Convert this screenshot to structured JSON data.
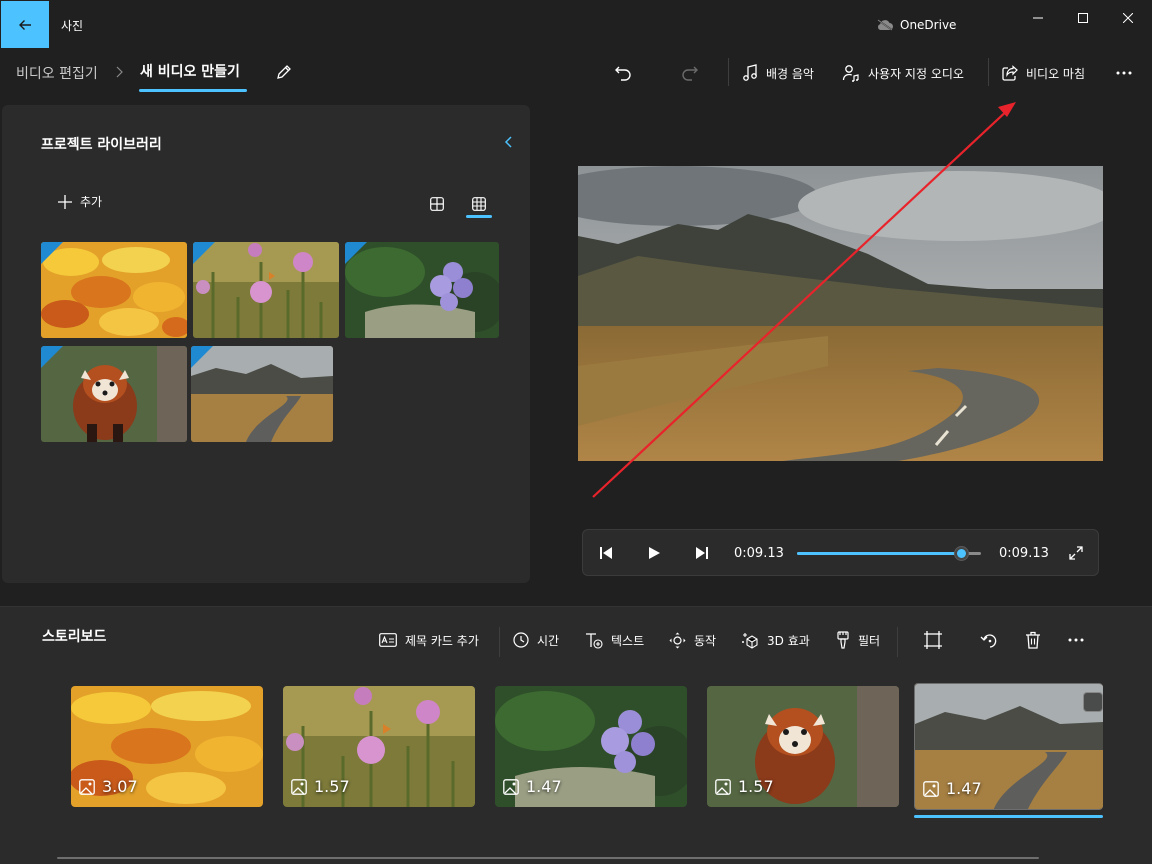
{
  "app": {
    "title": "사진",
    "cloud_label": "OneDrive"
  },
  "colors": {
    "accent": "#4cc2ff",
    "background": "#202020",
    "panel": "#2b2b2b",
    "annotation_arrow": "#e8232b"
  },
  "breadcrumb": {
    "root": "비디오 편집기",
    "current": "새 비디오 만들기"
  },
  "toolbar": {
    "undo_icon": "undo-icon",
    "redo_icon": "redo-icon",
    "background_music": "배경 음악",
    "custom_audio": "사용자 지정 오디오",
    "finish_video": "비디오 마침",
    "more_icon": "more-icon"
  },
  "library": {
    "title": "프로젝트 라이브러리",
    "add_label": "추가",
    "view_modes": [
      "large-grid-icon",
      "small-grid-icon"
    ],
    "items": [
      {
        "subject": "autumn-leaves"
      },
      {
        "subject": "pink-flowers"
      },
      {
        "subject": "purple-hyacinth"
      },
      {
        "subject": "red-panda"
      },
      {
        "subject": "mountain-road"
      }
    ]
  },
  "player": {
    "current_time": "0:09.13",
    "total_time": "0:09.13",
    "progress": 0.89
  },
  "storyboard": {
    "title": "스토리보드",
    "actions": {
      "title_card": "제목 카드 추가",
      "duration": "시간",
      "text": "텍스트",
      "motion": "동작",
      "effects_3d": "3D 효과",
      "filters": "필터"
    },
    "clips": [
      {
        "subject": "autumn-leaves",
        "duration": "3.07"
      },
      {
        "subject": "pink-flowers",
        "duration": "1.57"
      },
      {
        "subject": "purple-hyacinth",
        "duration": "1.47"
      },
      {
        "subject": "red-panda",
        "duration": "1.57"
      },
      {
        "subject": "mountain-road",
        "duration": "1.47",
        "selected": true
      }
    ]
  }
}
